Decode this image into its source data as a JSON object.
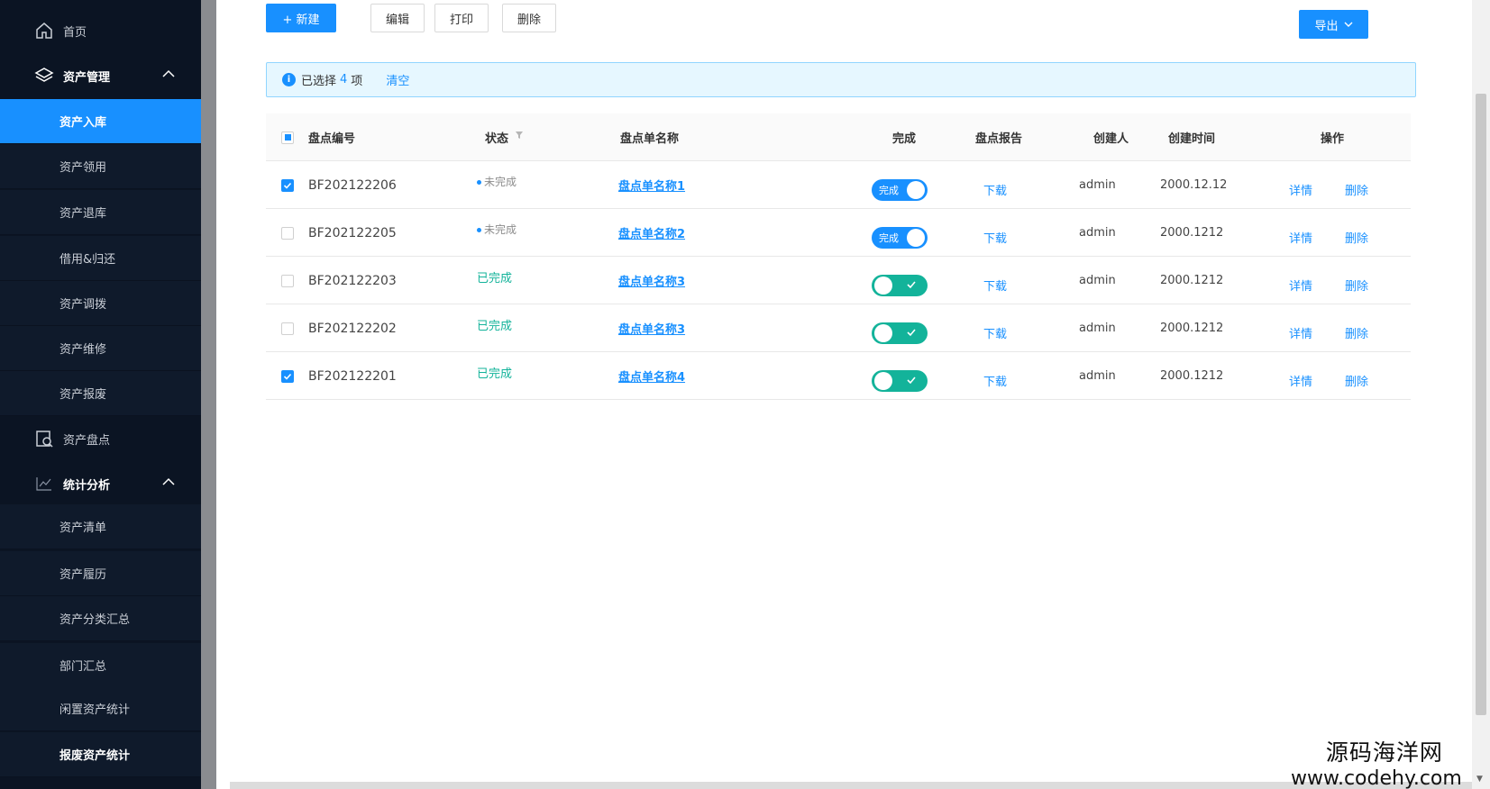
{
  "sidebar": {
    "home": "首页",
    "asset_mgmt": "资产管理",
    "asset_items": [
      "资产入库",
      "资产领用",
      "资产退库",
      "借用&归还",
      "资产调拨",
      "资产维修",
      "资产报废"
    ],
    "inventory": "资产盘点",
    "stats": "统计分析",
    "stats_items": [
      "资产清单",
      "资产履历",
      "资产分类汇总",
      "部门汇总",
      "闲置资产统计",
      "报废资产统计"
    ]
  },
  "toolbar": {
    "new_label": "+ 新建",
    "edit_label": "编辑",
    "print_label": "打印",
    "delete_label": "删除",
    "export_label": "导出"
  },
  "alert": {
    "selected_prefix": "已选择",
    "selected_count": "4",
    "selected_suffix": "项",
    "clear_label": "清空"
  },
  "table": {
    "headers": {
      "code": "盘点编号",
      "status": "状态",
      "name": "盘点单名称",
      "done": "完成",
      "report": "盘点报告",
      "creator": "创建人",
      "created": "创建时间",
      "ops": "操作"
    },
    "rows": [
      {
        "checked": true,
        "code": "BF202122206",
        "status": "未完成",
        "name": "盘点单名称1",
        "toggle": "完成",
        "report": "下载",
        "creator": "admin",
        "created": "2000.12.12",
        "detail": "详情",
        "del": "删除"
      },
      {
        "checked": false,
        "code": "BF202122205",
        "status": "未完成",
        "name": "盘点单名称2",
        "toggle": "完成",
        "report": "下载",
        "creator": "admin",
        "created": "2000.1212",
        "detail": "详情",
        "del": "删除"
      },
      {
        "checked": false,
        "code": "BF202122203",
        "status": "已完成",
        "name": "盘点单名称3",
        "toggle": "",
        "report": "下载",
        "creator": "admin",
        "created": "2000.1212",
        "detail": "详情",
        "del": "删除"
      },
      {
        "checked": false,
        "code": "BF202122202",
        "status": "已完成",
        "name": "盘点单名称3",
        "toggle": "",
        "report": "下载",
        "creator": "admin",
        "created": "2000.1212",
        "detail": "详情",
        "del": "删除"
      },
      {
        "checked": true,
        "code": "BF202122201",
        "status": "已完成",
        "name": "盘点单名称4",
        "toggle": "",
        "report": "下载",
        "creator": "admin",
        "created": "2000.1212",
        "detail": "详情",
        "del": "删除"
      }
    ]
  },
  "watermark": {
    "line1": "源码海洋网",
    "line2": "www.codehy.com"
  },
  "colors": {
    "primary": "#1890ff",
    "success": "#13b39a",
    "sidebar_bg": "#0b1423"
  },
  "icons": [
    "home-icon",
    "layers-icon",
    "chevron-up-icon",
    "inventory-icon",
    "chart-icon",
    "chevron-down-icon",
    "info-icon",
    "filter-icon",
    "check-icon"
  ]
}
